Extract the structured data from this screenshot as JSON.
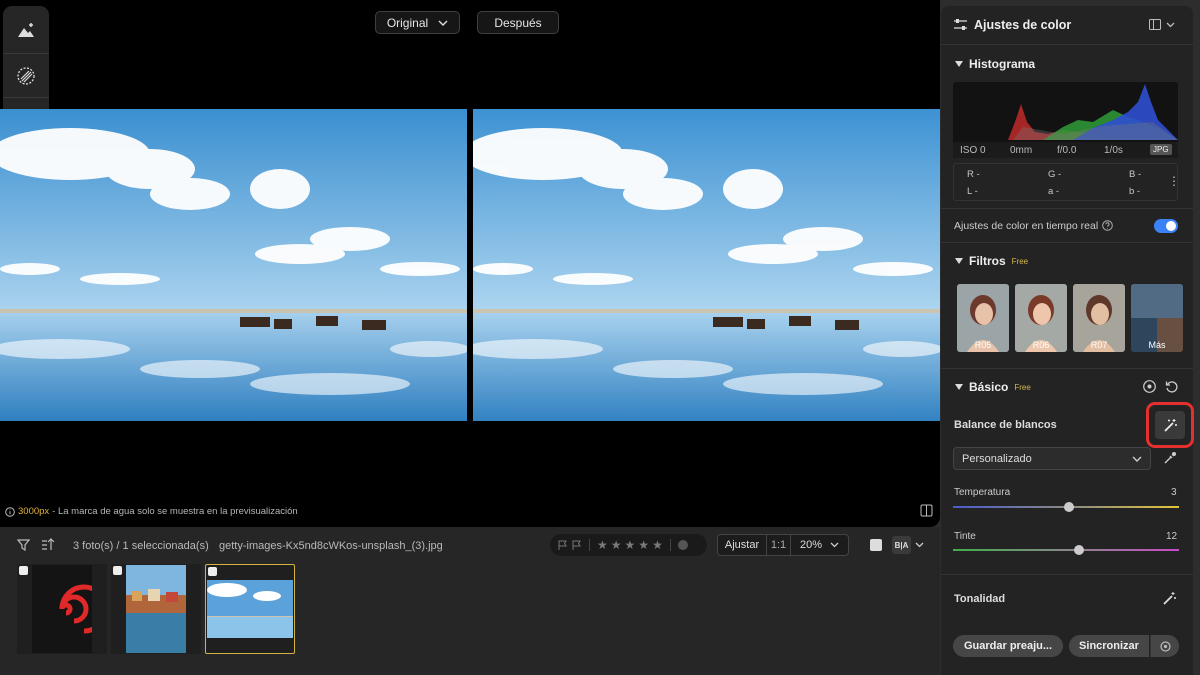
{
  "viewer": {
    "before_label": "Original",
    "after_label": "Después",
    "watermark_px": "3000px",
    "watermark_text": "- La marca de agua solo se muestra en la previsualización"
  },
  "left_tools": {
    "icons": [
      "landscape-sparkle-icon",
      "texture-icon",
      "history-clock-icon"
    ]
  },
  "filmstrip": {
    "count": "3 foto(s) / 1 seleccionada(s)",
    "filename": "getty-images-Kx5nd8cWKos-unsplash_(3).jpg",
    "fit_label": "Ajustar",
    "one_to_one": "1:1",
    "zoom": "20%",
    "view_label": "B|A",
    "stars": 5
  },
  "panel": {
    "title": "Ajustes de color",
    "histogram": {
      "title": "Histograma",
      "iso": "ISO 0",
      "focal": "0mm",
      "aperture": "f/0.0",
      "shutter": "1/0s",
      "format": "JPG"
    },
    "readout": {
      "r": "R -",
      "g": "G -",
      "b": "B -",
      "l": "L -",
      "a": "a -",
      "b2": "b -"
    },
    "realtime_label": "Ajustes de color en tiempo real",
    "realtime_on": true,
    "filters": {
      "title": "Filtros",
      "badge": "Free",
      "items": [
        "R05",
        "R06",
        "R07",
        "Más"
      ]
    },
    "basic": {
      "title": "Básico",
      "badge": "Free",
      "wb_label": "Balance de blancos",
      "wb_preset": "Personalizado",
      "temperature_label": "Temperatura",
      "temperature_value": "3",
      "tint_label": "Tinte",
      "tint_value": "12",
      "tonality_label": "Tonalidad"
    },
    "save_label": "Guardar preaju...",
    "sync_label": "Sincronizar"
  },
  "colors": {
    "accent": "#3b82f6",
    "highlight": "#e53030",
    "selected": "#d4b345",
    "watermark_px": "#e6b33a"
  }
}
